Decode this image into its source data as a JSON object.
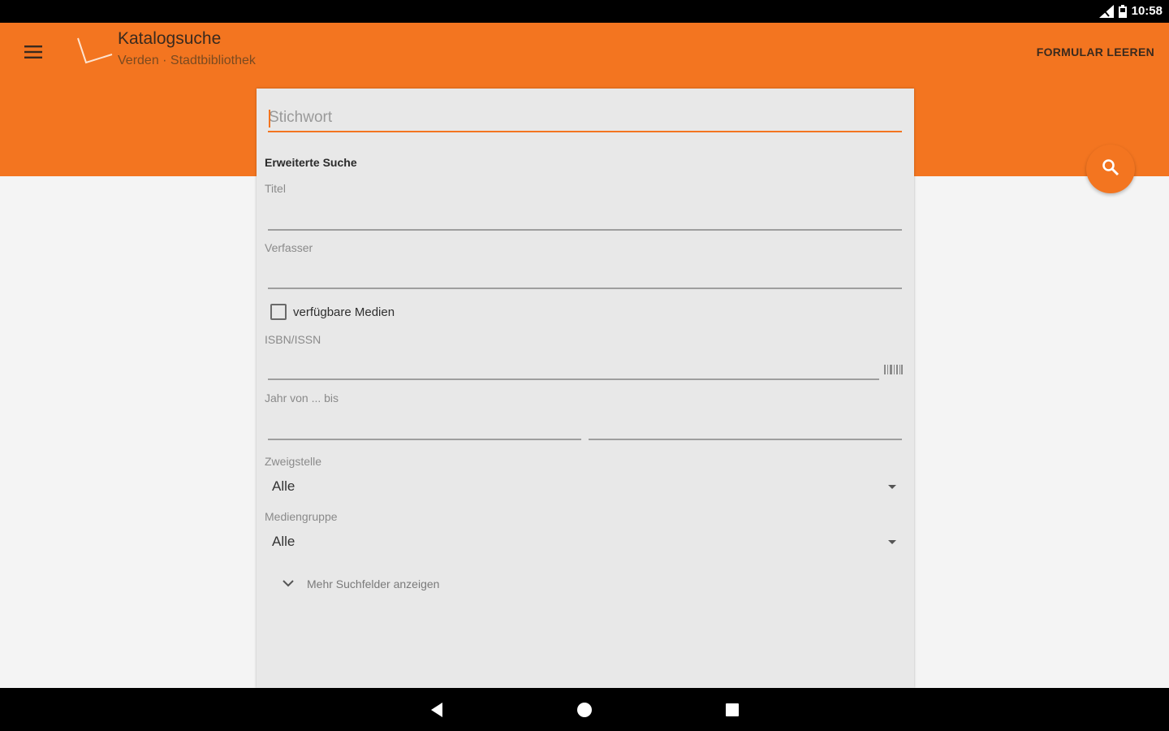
{
  "status_bar": {
    "time": "10:58",
    "icons": [
      "signal-icon",
      "battery-icon"
    ]
  },
  "app_bar": {
    "title": "Katalogsuche",
    "subtitle": "Verden · Stadtbibliothek",
    "clear_button": "FORMULAR LEEREN",
    "menu_icon": "hamburger-menu-icon",
    "logo_icon": "library-logo-icon"
  },
  "search": {
    "keyword_placeholder": "Stichwort",
    "keyword_value": "",
    "fab_icon": "search-icon"
  },
  "advanced": {
    "heading": "Erweiterte Suche",
    "title_label": "Titel",
    "author_label": "Verfasser",
    "available_checkbox_label": "verfügbare Medien",
    "available_checked": false,
    "isbn_label": "ISBN/ISSN",
    "barcode_icon": "barcode-icon",
    "year_label": "Jahr von ... bis",
    "branch_label": "Zweigstelle",
    "branch_value": "Alle",
    "media_group_label": "Mediengruppe",
    "media_group_value": "Alle",
    "more_fields": "Mehr Suchfelder anzeigen"
  },
  "nav_bar": {
    "buttons": [
      "back-icon",
      "home-icon",
      "recents-icon"
    ]
  },
  "colors": {
    "accent": "#f37520",
    "card": "#e8e8e8",
    "background": "#f4f4f4"
  }
}
